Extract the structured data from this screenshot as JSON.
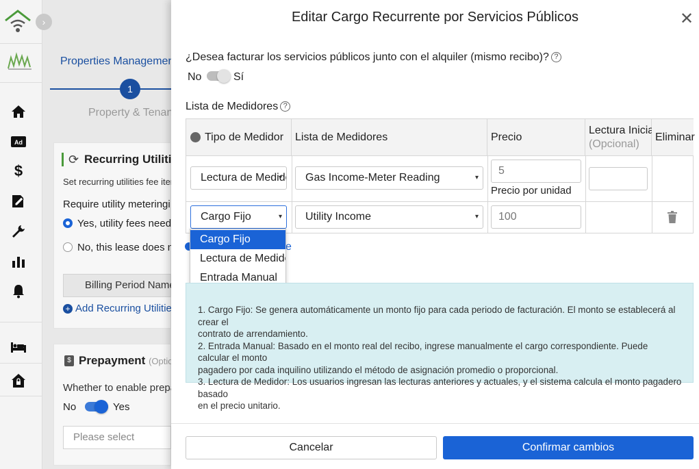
{
  "background": {
    "top_nav_title": "Properties Management |",
    "stepper": {
      "step_number": "1",
      "step_label": "Property & Tenan"
    },
    "recurring_card": {
      "title": "Recurring Utilitie",
      "description": "Set recurring utilities fee iter",
      "metering_question": "Require utility meteringi",
      "option_yes": "Yes, utility fees need t",
      "option_no": "No, this lease does no",
      "billing_button": "Billing Period Name",
      "add_link": "Add Recurring Utilities"
    },
    "prepayment_card": {
      "title": "Prepayment",
      "title_suffix": "(Option",
      "question": "Whether to enable prepa",
      "toggle_no": "No",
      "toggle_yes": "Yes",
      "select_placeholder": "Please select"
    }
  },
  "modal": {
    "title": "Editar Cargo Recurrente por Servicios Públicos",
    "billing_question": "¿Desea facturar los servicios públicos junto con el alquiler (mismo recibo)?",
    "toggle_no": "No",
    "toggle_yes": "Sí",
    "meter_list_label": "Lista de Medidores",
    "table": {
      "headers": {
        "meter_type": "Tipo de Medidor",
        "meter_list": "Lista de Medidores",
        "price": "Precio",
        "initial_reading": "Lectura Inicial",
        "initial_reading_note": "(Opcional)",
        "delete": "Eliminar"
      },
      "rows": [
        {
          "meter_type": "Lectura de Medidor",
          "meter_list": "Gas Income-Meter Reading",
          "price": "5",
          "price_note": "Precio por unidad",
          "initial_reading": ""
        },
        {
          "meter_type": "Cargo Fijo",
          "meter_list": "Utility Income",
          "price": "100"
        }
      ]
    },
    "dropdown_options": [
      "Cargo Fijo",
      "Lectura de Medidor",
      "Entrada Manual"
    ],
    "hidden_text_fragment": "e",
    "info_lines": [
      "1. Cargo Fijo: Se genera automáticamente un monto fijo para cada periodo de facturación. El monto se establecerá al crear el",
      "contrato de arrendamiento.",
      "2. Entrada Manual: Basado en el monto real del recibo, ingrese manualmente el cargo correspondiente. Puede calcular el monto",
      "pagadero por cada inquilino utilizando el método de asignación promedio o proporcional.",
      "3. Lectura de Medidor: Los usuarios ingresan las lecturas anteriores y actuales, y el sistema calcula el monto pagadero basado",
      "en el precio unitario."
    ],
    "cancel_label": "Cancelar",
    "confirm_label": "Confirmar cambios"
  },
  "colors": {
    "accent": "#1a63d6",
    "info_bg": "#d8eff2",
    "brand_green": "#4a9a3a"
  }
}
